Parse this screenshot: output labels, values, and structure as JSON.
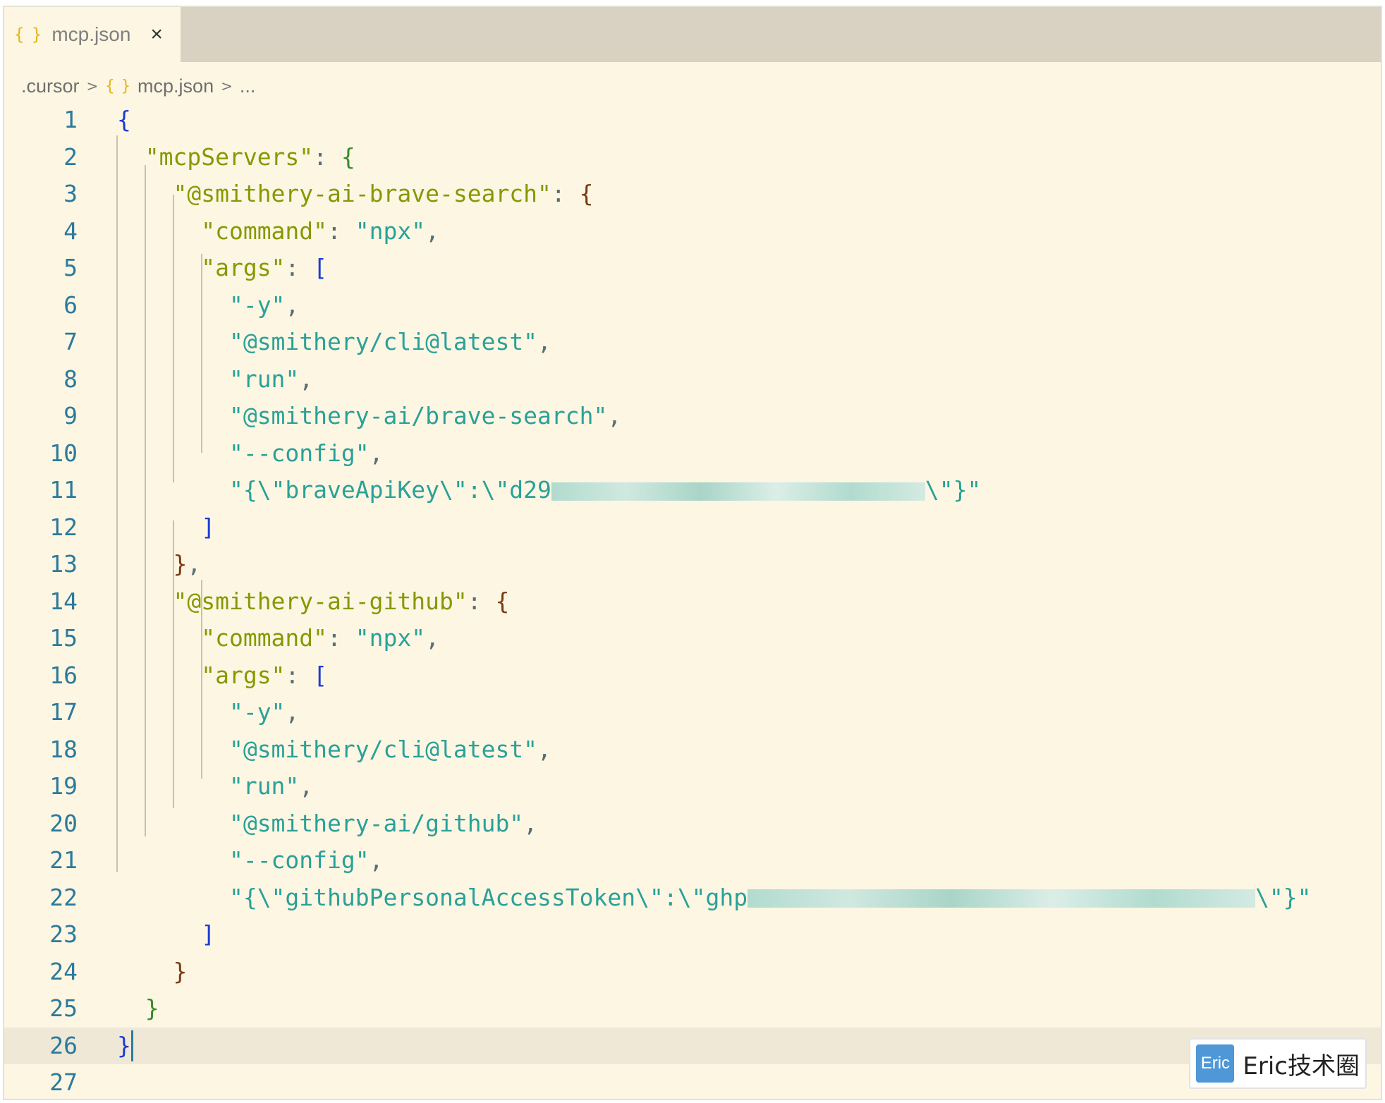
{
  "tab": {
    "icon": "json-braces-icon",
    "label": "mcp.json",
    "close": "×"
  },
  "breadcrumb": {
    "folder": ".cursor",
    "file": "mcp.json",
    "tail": "..."
  },
  "editor": {
    "line_numbers": [
      "1",
      "2",
      "3",
      "4",
      "5",
      "6",
      "7",
      "8",
      "9",
      "10",
      "11",
      "12",
      "13",
      "14",
      "15",
      "16",
      "17",
      "18",
      "19",
      "20",
      "21",
      "22",
      "23",
      "24",
      "25",
      "26",
      "27"
    ],
    "code": {
      "l1": "{",
      "l2_key": "\"mcpServers\"",
      "l3_key": "\"@smithery-ai-brave-search\"",
      "l4_key": "\"command\"",
      "l4_val": "\"npx\"",
      "l5_key": "\"args\"",
      "l6": "\"-y\"",
      "l7": "\"@smithery/cli@latest\"",
      "l8": "\"run\"",
      "l9": "\"@smithery-ai/brave-search\"",
      "l10": "\"--config\"",
      "l11_prefix": "\"{\\\"braveApiKey\\\":\\\"d29",
      "l11_suffix": "\\\"}\"",
      "l14_key": "\"@smithery-ai-github\"",
      "l15_key": "\"command\"",
      "l15_val": "\"npx\"",
      "l16_key": "\"args\"",
      "l17": "\"-y\"",
      "l18": "\"@smithery/cli@latest\"",
      "l19": "\"run\"",
      "l20": "\"@smithery-ai/github\"",
      "l21": "\"--config\"",
      "l22_prefix": "\"{\\\"githubPersonalAccessToken\\\":\\\"ghp",
      "l22_suffix": "\\\"}\""
    },
    "active_line": 26
  },
  "watermark": {
    "logo": "Eric",
    "text": "Eric技术圈"
  },
  "colors": {
    "background": "#fdf6e3",
    "key": "#859900",
    "string": "#2aa198",
    "line_number": "#2c7a9c",
    "tab_bar": "#d9d2c2"
  }
}
